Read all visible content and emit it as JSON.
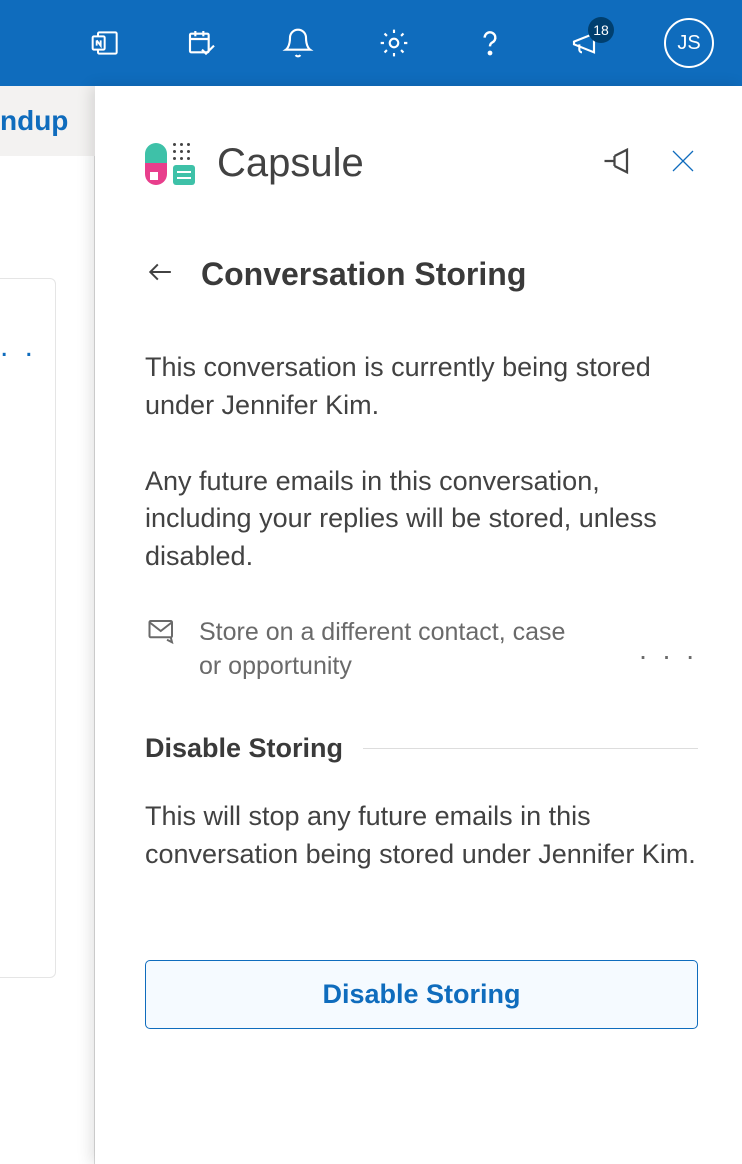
{
  "topbar": {
    "badge_count": "18",
    "avatar_initials": "JS"
  },
  "background": {
    "tab_partial": "ndup",
    "ellipsis": ". ."
  },
  "panel": {
    "title": "Capsule",
    "heading": "Conversation Storing",
    "paragraph1": "This conversation is currently being stored under Jennifer Kim.",
    "paragraph2": "Any future emails in this conversation, including your replies will be stored, unless disabled.",
    "store_different": "Store on a different contact, case or opportunity",
    "more_dots": ". . .",
    "disable_heading": "Disable Storing",
    "disable_body": "This will stop any future emails in this conversation being stored under Jennifer Kim.",
    "disable_button": "Disable Storing"
  }
}
